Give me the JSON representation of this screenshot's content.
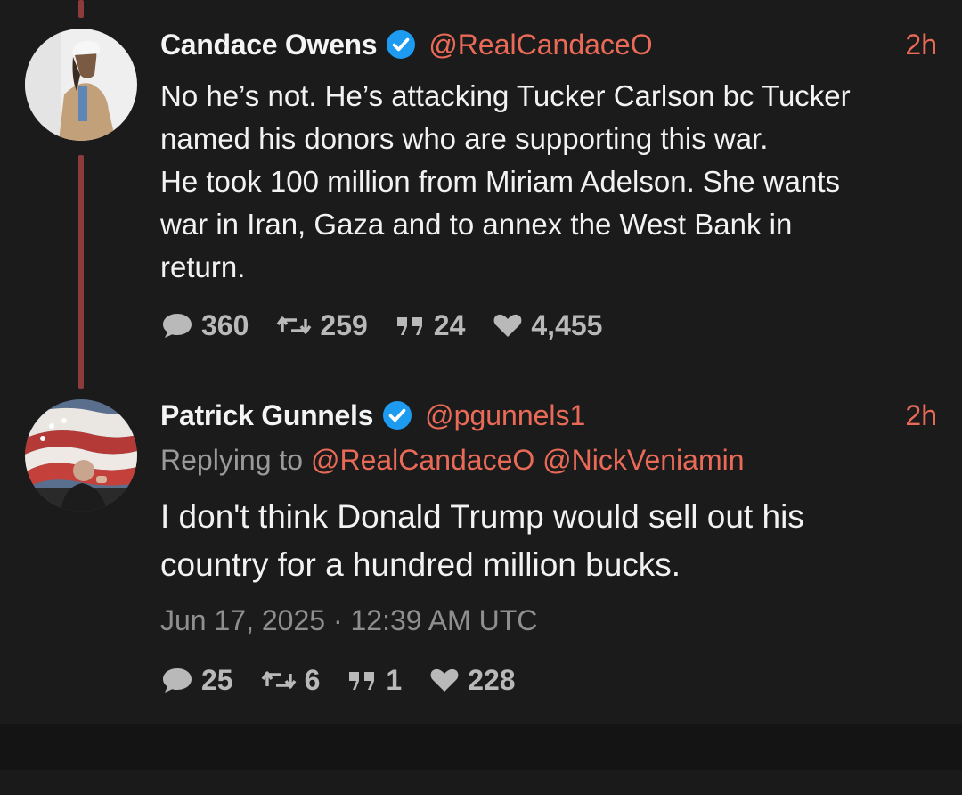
{
  "tweets": [
    {
      "author_name": "Candace Owens",
      "author_handle": "@RealCandaceO",
      "time_ago": "2h",
      "verified": true,
      "text_lines": [
        "No he’s not. He’s attacking Tucker Carlson bc Tucker",
        "named his donors who are supporting this war.",
        "He took 100 million from Miriam Adelson. She wants",
        "war in Iran, Gaza and to annex the West Bank in",
        "return."
      ],
      "stats": {
        "replies": "360",
        "retweets": "259",
        "quotes": "24",
        "likes": "4,455"
      }
    },
    {
      "author_name": "Patrick Gunnels",
      "author_handle": "@pgunnels1",
      "time_ago": "2h",
      "verified": true,
      "replying_prefix": "Replying to",
      "replying_mentions": [
        "@RealCandaceO",
        "@NickVeniamin"
      ],
      "text_lines": [
        "I don't think Donald Trump would sell out his",
        "country for a hundred million bucks."
      ],
      "timestamp": "Jun 17, 2025 · 12:39 AM UTC",
      "stats": {
        "replies": "25",
        "retweets": "6",
        "quotes": "1",
        "likes": "228"
      }
    }
  ],
  "icons": {
    "reply": "speech-bubble-icon",
    "retweet": "retweet-icon",
    "quote": "quote-icon",
    "like": "heart-icon",
    "verified": "verified-badge-icon"
  },
  "colors": {
    "accent": "#ea6a58",
    "thread_line": "#8d3b3b",
    "verified": "#1d9bf0",
    "background": "#1b1b1b"
  }
}
